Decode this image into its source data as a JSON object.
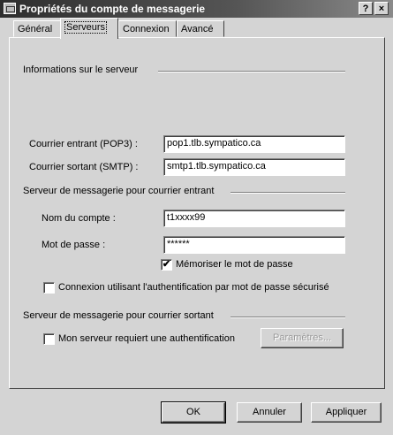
{
  "window": {
    "title": "Propriétés du compte de messagerie",
    "help_label": "?",
    "close_label": "×"
  },
  "tabs": [
    {
      "label": "Général"
    },
    {
      "label": "Serveurs"
    },
    {
      "label": "Connexion"
    },
    {
      "label": "Avancé"
    }
  ],
  "server_info": {
    "heading": "Informations sur le serveur",
    "incoming_label": "Courrier entrant (POP3) :",
    "incoming_value": "pop1.tlb.sympatico.ca",
    "outgoing_label": "Courrier sortant (SMTP) :",
    "outgoing_value": "smtp1.tlb.sympatico.ca"
  },
  "incoming_server": {
    "heading": "Serveur de messagerie pour courrier entrant",
    "account_label": "Nom du compte :",
    "account_value": "t1xxxx99",
    "password_label": "Mot de passe :",
    "password_value": "******",
    "remember_label": "Mémoriser le mot de passe",
    "remember_checked": "✔",
    "spa_label": "Connexion utilisant l'authentification par mot de passe sécurisé",
    "spa_checked": ""
  },
  "outgoing_server": {
    "heading": "Serveur de messagerie pour courrier sortant",
    "auth_label": "Mon serveur requiert une authentification",
    "auth_checked": "",
    "settings_label": "Paramètres..."
  },
  "footer": {
    "ok_label": "OK",
    "cancel_label": "Annuler",
    "apply_label": "Appliquer"
  }
}
